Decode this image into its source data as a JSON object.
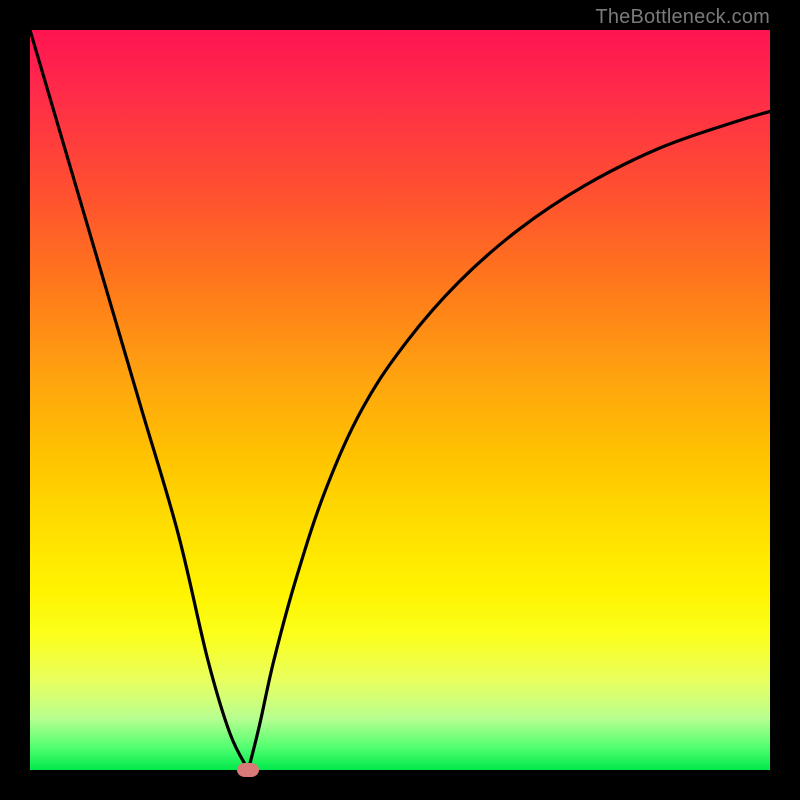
{
  "attribution": "TheBottleneck.com",
  "chart_data": {
    "type": "line",
    "title": "",
    "xlabel": "",
    "ylabel": "",
    "xlim": [
      0,
      100
    ],
    "ylim": [
      0,
      100
    ],
    "series": [
      {
        "name": "left-branch",
        "x": [
          0,
          5,
          10,
          15,
          20,
          24,
          27,
          29.5
        ],
        "y": [
          100,
          83,
          66,
          49,
          32,
          15,
          5,
          0
        ]
      },
      {
        "name": "right-branch",
        "x": [
          29.5,
          31,
          33,
          36,
          40,
          45,
          51,
          58,
          66,
          75,
          85,
          95,
          100
        ],
        "y": [
          0,
          6,
          15,
          26,
          38,
          49,
          58,
          66,
          73,
          79,
          84,
          87.5,
          89
        ]
      }
    ],
    "marker": {
      "x": 29.5,
      "y": 0,
      "color": "#d87a78"
    },
    "background_gradient": {
      "type": "vertical",
      "stops": [
        {
          "pos": 0.0,
          "color": "#ff1451"
        },
        {
          "pos": 0.5,
          "color": "#ffb400"
        },
        {
          "pos": 0.8,
          "color": "#fff400"
        },
        {
          "pos": 1.0,
          "color": "#00e84a"
        }
      ]
    }
  }
}
